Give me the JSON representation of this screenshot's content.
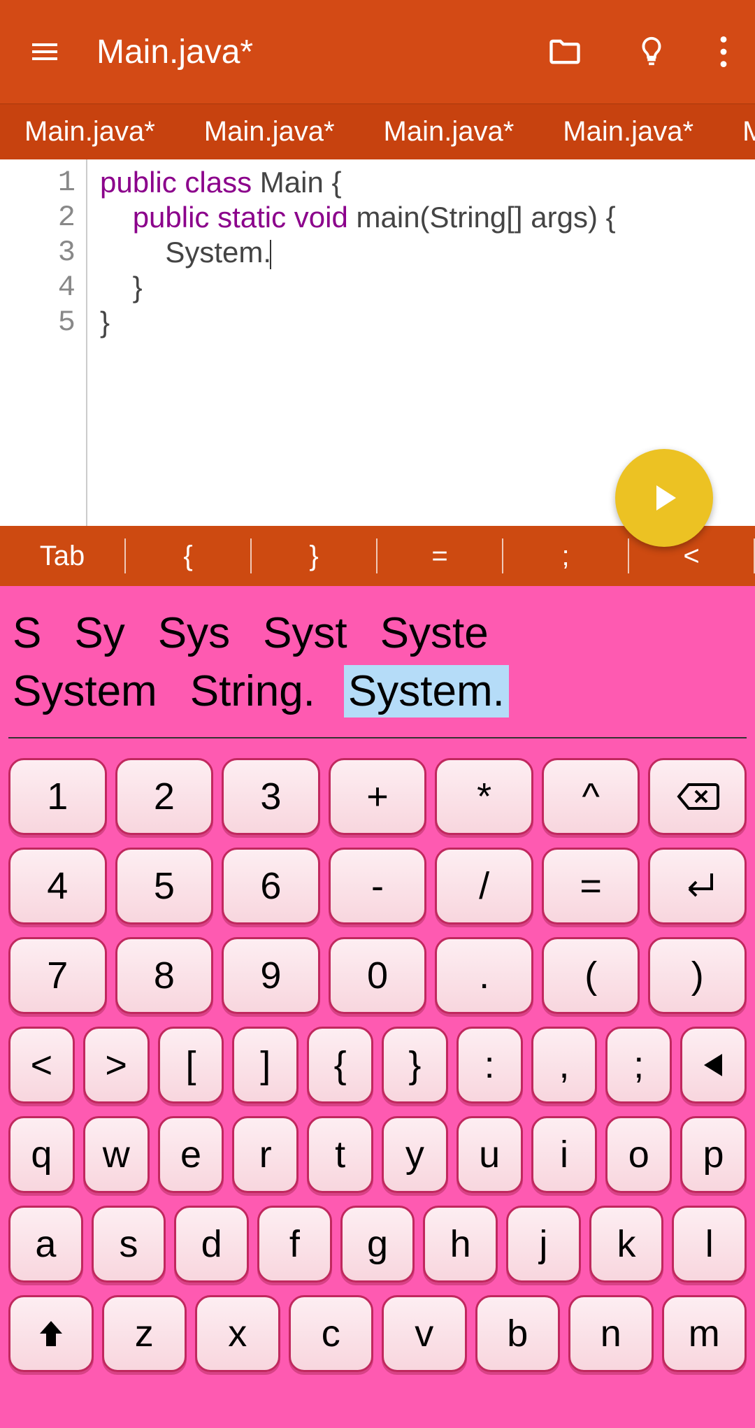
{
  "header": {
    "title": "Main.java*"
  },
  "tabs": [
    "Main.java*",
    "Main.java*",
    "Main.java*",
    "Main.java*",
    "M"
  ],
  "code": {
    "lines": [
      "1",
      "2",
      "3",
      "4",
      "5"
    ],
    "l1_kw": "public class ",
    "l1_txt": "Main {",
    "l2_sp": "    ",
    "l2_kw": "public static void ",
    "l2_txt": "main(String[] args) {",
    "l3_sp": "        ",
    "l3_txt": "System.",
    "l4": "    }",
    "l5": "}"
  },
  "sym_strip": [
    "Tab",
    "{",
    "}",
    "=",
    ";",
    "<"
  ],
  "suggestions": {
    "row1": [
      "S",
      "Sy",
      "Sys",
      "Syst",
      "Syste"
    ],
    "row2": [
      "System",
      "String.",
      "System."
    ]
  },
  "keys": {
    "r1": [
      "1",
      "2",
      "3",
      "+",
      "*",
      "^"
    ],
    "r2": [
      "4",
      "5",
      "6",
      "-",
      "/",
      "="
    ],
    "r3": [
      "7",
      "8",
      "9",
      "0",
      ".",
      "(",
      ")"
    ],
    "r4": [
      "<",
      ">",
      "[",
      "]",
      "{",
      "}",
      ":",
      ",",
      ";"
    ],
    "r5": [
      "q",
      "w",
      "e",
      "r",
      "t",
      "y",
      "u",
      "i",
      "o",
      "p"
    ],
    "r6": [
      "a",
      "s",
      "d",
      "f",
      "g",
      "h",
      "j",
      "k",
      "l"
    ],
    "r7": [
      "z",
      "x",
      "c",
      "v",
      "b",
      "n",
      "m"
    ]
  }
}
